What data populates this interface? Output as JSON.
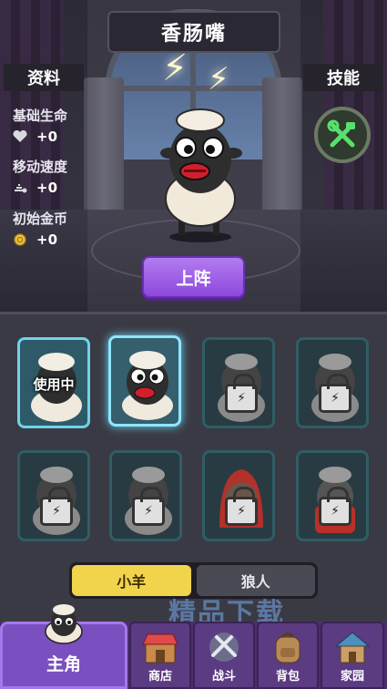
{
  "header": {
    "title": "香肠嘴"
  },
  "info_panel": {
    "heading": "资料",
    "stats": [
      {
        "label": "基础生命",
        "value": "+0",
        "icon": "heart-icon"
      },
      {
        "label": "移动速度",
        "value": "+0",
        "icon": "speed-icon"
      },
      {
        "label": "初始金币",
        "value": "+0",
        "icon": "coin-icon"
      }
    ]
  },
  "skill_panel": {
    "heading": "技能",
    "icon": "wrench-hammer-icon"
  },
  "deploy_button": {
    "label": "上阵"
  },
  "roster": {
    "cards": [
      {
        "status": "使用中",
        "locked": false
      },
      {
        "status": "",
        "locked": false
      },
      {
        "status": "",
        "locked": true
      },
      {
        "status": "",
        "locked": true
      },
      {
        "status": "",
        "locked": true
      },
      {
        "status": "",
        "locked": true
      },
      {
        "status": "",
        "locked": true
      },
      {
        "status": "",
        "locked": true
      }
    ]
  },
  "tabs": [
    {
      "label": "小羊",
      "active": true
    },
    {
      "label": "狼人",
      "active": false
    }
  ],
  "nav": {
    "items": [
      {
        "label": "主角",
        "icon": "sheep-icon",
        "active": true
      },
      {
        "label": "商店",
        "icon": "shop-icon",
        "active": false
      },
      {
        "label": "战斗",
        "icon": "battle-icon",
        "active": false
      },
      {
        "label": "背包",
        "icon": "backpack-icon",
        "active": false
      },
      {
        "label": "家园",
        "icon": "home-icon",
        "active": false
      }
    ]
  },
  "watermark": "精品下载",
  "colors": {
    "accent_purple": "#8d48dd",
    "tab_active": "#f2d34c",
    "card_border": "#6fd3ea"
  }
}
